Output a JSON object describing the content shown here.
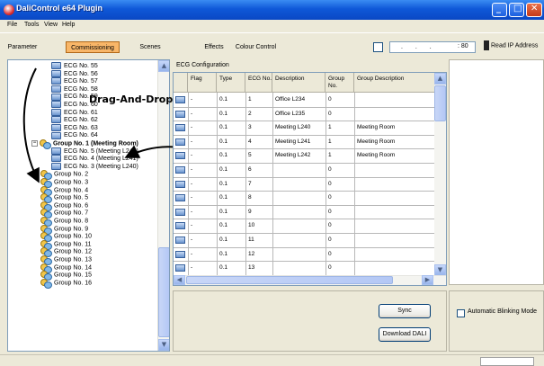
{
  "window": {
    "title": "DaliControl e64 Plugin"
  },
  "menu": [
    "File",
    "Tools",
    "View",
    "Help"
  ],
  "tabs": [
    {
      "label": "Parameter",
      "active": false
    },
    {
      "label": "Commissioning",
      "active": true
    },
    {
      "label": "Scenes",
      "active": false
    },
    {
      "label": "Effects",
      "active": false
    },
    {
      "label": "Colour Control",
      "active": false
    }
  ],
  "ip": {
    "value": ".   .   .",
    "port": ": 80",
    "read_label": "Read IP Address"
  },
  "tree": {
    "ecg_items": [
      "ECG No. 55",
      "ECG No. 56",
      "ECG No. 57",
      "ECG No. 58",
      "ECG No. 59",
      "ECG No. 60",
      "ECG No. 61",
      "ECG No. 62",
      "ECG No. 63",
      "ECG No. 64"
    ],
    "open_group": "Group No. 1 (Meeting Room)",
    "open_group_children": [
      "ECG No. 5 (Meeting L242)",
      "ECG No. 4 (Meeting L241)",
      "ECG No. 3 (Meeting L240)"
    ],
    "groups": [
      "Group No. 2",
      "Group No. 3",
      "Group No. 4",
      "Group No. 5",
      "Group No. 6",
      "Group No. 7",
      "Group No. 8",
      "Group No. 9",
      "Group No. 10",
      "Group No. 11",
      "Group No. 12",
      "Group No. 13",
      "Group No. 14",
      "Group No. 15",
      "Group No. 16"
    ]
  },
  "annotation": "Drag-And-Drop",
  "ecg_config": {
    "title": "ECG Configuration",
    "columns": [
      "Flag",
      "Type",
      "ECG No.",
      "Description",
      "Group No.",
      "Group Description"
    ],
    "rows": [
      [
        "-",
        "0.1",
        "1",
        "Office L234",
        "0",
        ""
      ],
      [
        "-",
        "0.1",
        "2",
        "Office L235",
        "0",
        ""
      ],
      [
        "-",
        "0.1",
        "3",
        "Meeting L240",
        "1",
        "Meeting Room"
      ],
      [
        "-",
        "0.1",
        "4",
        "Meeting L241",
        "1",
        "Meeting Room"
      ],
      [
        "-",
        "0.1",
        "5",
        "Meeting L242",
        "1",
        "Meeting Room"
      ],
      [
        "-",
        "0.1",
        "6",
        "",
        "0",
        ""
      ],
      [
        "-",
        "0.1",
        "7",
        "",
        "0",
        ""
      ],
      [
        "-",
        "0.1",
        "8",
        "",
        "0",
        ""
      ],
      [
        "-",
        "0.1",
        "9",
        "",
        "0",
        ""
      ],
      [
        "-",
        "0.1",
        "10",
        "",
        "0",
        ""
      ],
      [
        "-",
        "0.1",
        "11",
        "",
        "0",
        ""
      ],
      [
        "-",
        "0.1",
        "12",
        "",
        "0",
        ""
      ],
      [
        "-",
        "0.1",
        "13",
        "",
        "0",
        ""
      ]
    ]
  },
  "buttons": {
    "sync": "Sync",
    "download": "Download DALI"
  },
  "blinking": {
    "label": "Automatic Blinking Mode",
    "checked": false
  }
}
